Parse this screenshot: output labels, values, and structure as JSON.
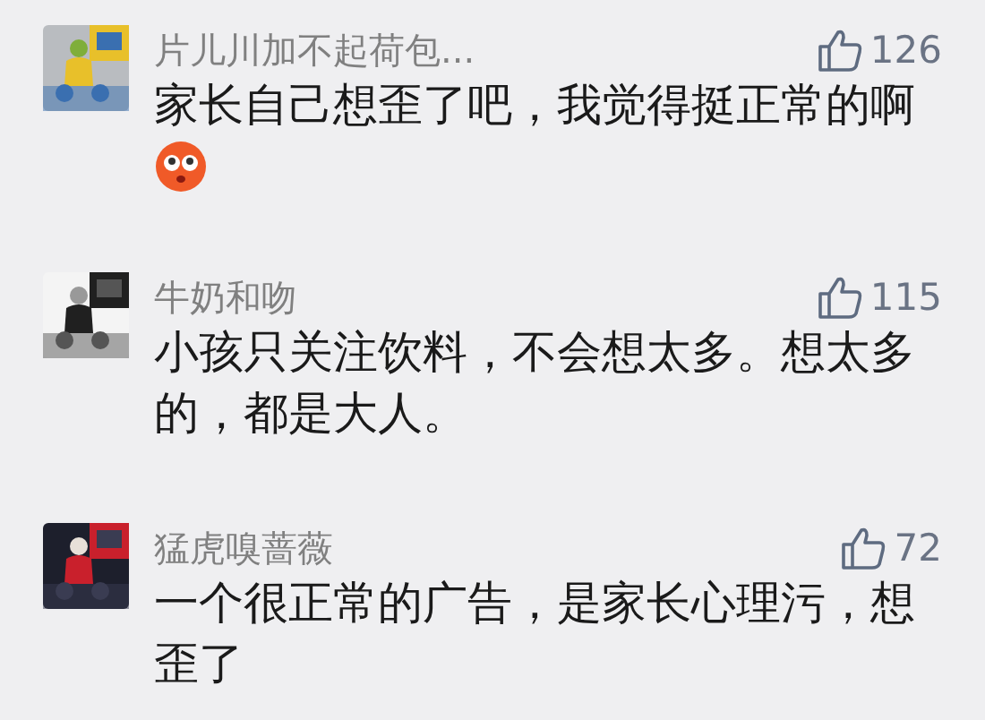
{
  "comments": [
    {
      "name": "片儿川加不起荷包...",
      "text": "家长自己想歪了吧，我觉得挺正常的啊",
      "emoji": true,
      "likes": "126"
    },
    {
      "name": "牛奶和吻",
      "text": "小孩只关注饮料，不会想太多。想太多的，都是大人。",
      "emoji": false,
      "likes": "115"
    },
    {
      "name": "猛虎嗅蔷薇",
      "text": "一个很正常的广告，是家长心理污，想歪了",
      "emoji": false,
      "likes": "72"
    }
  ]
}
